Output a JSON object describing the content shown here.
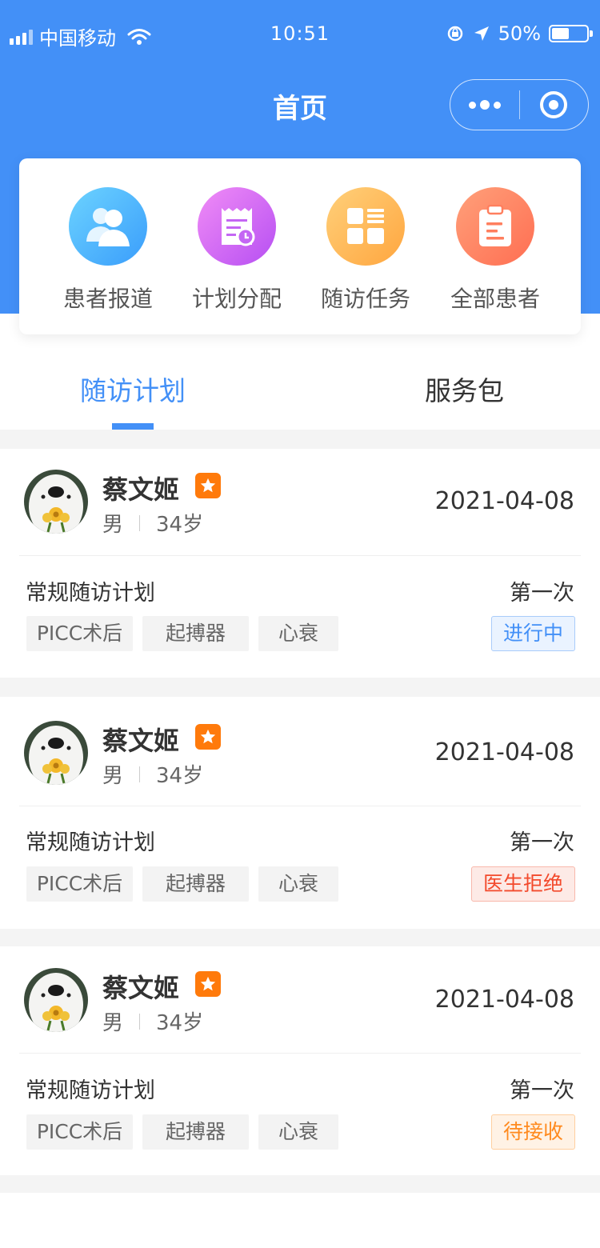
{
  "status_bar": {
    "carrier": "中国移动",
    "time": "10:51",
    "battery": "50%",
    "battery_level": 0.5
  },
  "nav": {
    "title": "首页"
  },
  "quick_menu": [
    {
      "label": "患者报道",
      "icon": "users-icon"
    },
    {
      "label": "计划分配",
      "icon": "schedule-receipt-icon"
    },
    {
      "label": "随访任务",
      "icon": "grid-list-icon"
    },
    {
      "label": "全部患者",
      "icon": "clipboard-icon"
    }
  ],
  "tabs": [
    {
      "label": "随访计划",
      "active": true
    },
    {
      "label": "服务包",
      "active": false
    }
  ],
  "colors": {
    "primary": "#4390f7",
    "badge": "#ff7a0b",
    "status_in_progress": "#4390f7",
    "status_rejected": "#f34a2c",
    "status_pending": "#ff8a1e"
  },
  "plans": [
    {
      "name": "蔡文姬",
      "gender": "男",
      "age": "34岁",
      "date": "2021-04-08",
      "plan": "常规随访计划",
      "count": "第一次",
      "tags": [
        "PICC术后",
        "起搏器",
        "心衰"
      ],
      "status": "进行中"
    },
    {
      "name": "蔡文姬",
      "gender": "男",
      "age": "34岁",
      "date": "2021-04-08",
      "plan": "常规随访计划",
      "count": "第一次",
      "tags": [
        "PICC术后",
        "起搏器",
        "心衰"
      ],
      "status": "医生拒绝"
    },
    {
      "name": "蔡文姬",
      "gender": "男",
      "age": "34岁",
      "date": "2021-04-08",
      "plan": "常规随访计划",
      "count": "第一次",
      "tags": [
        "PICC术后",
        "起搏器",
        "心衰"
      ],
      "status": "待接收"
    }
  ]
}
